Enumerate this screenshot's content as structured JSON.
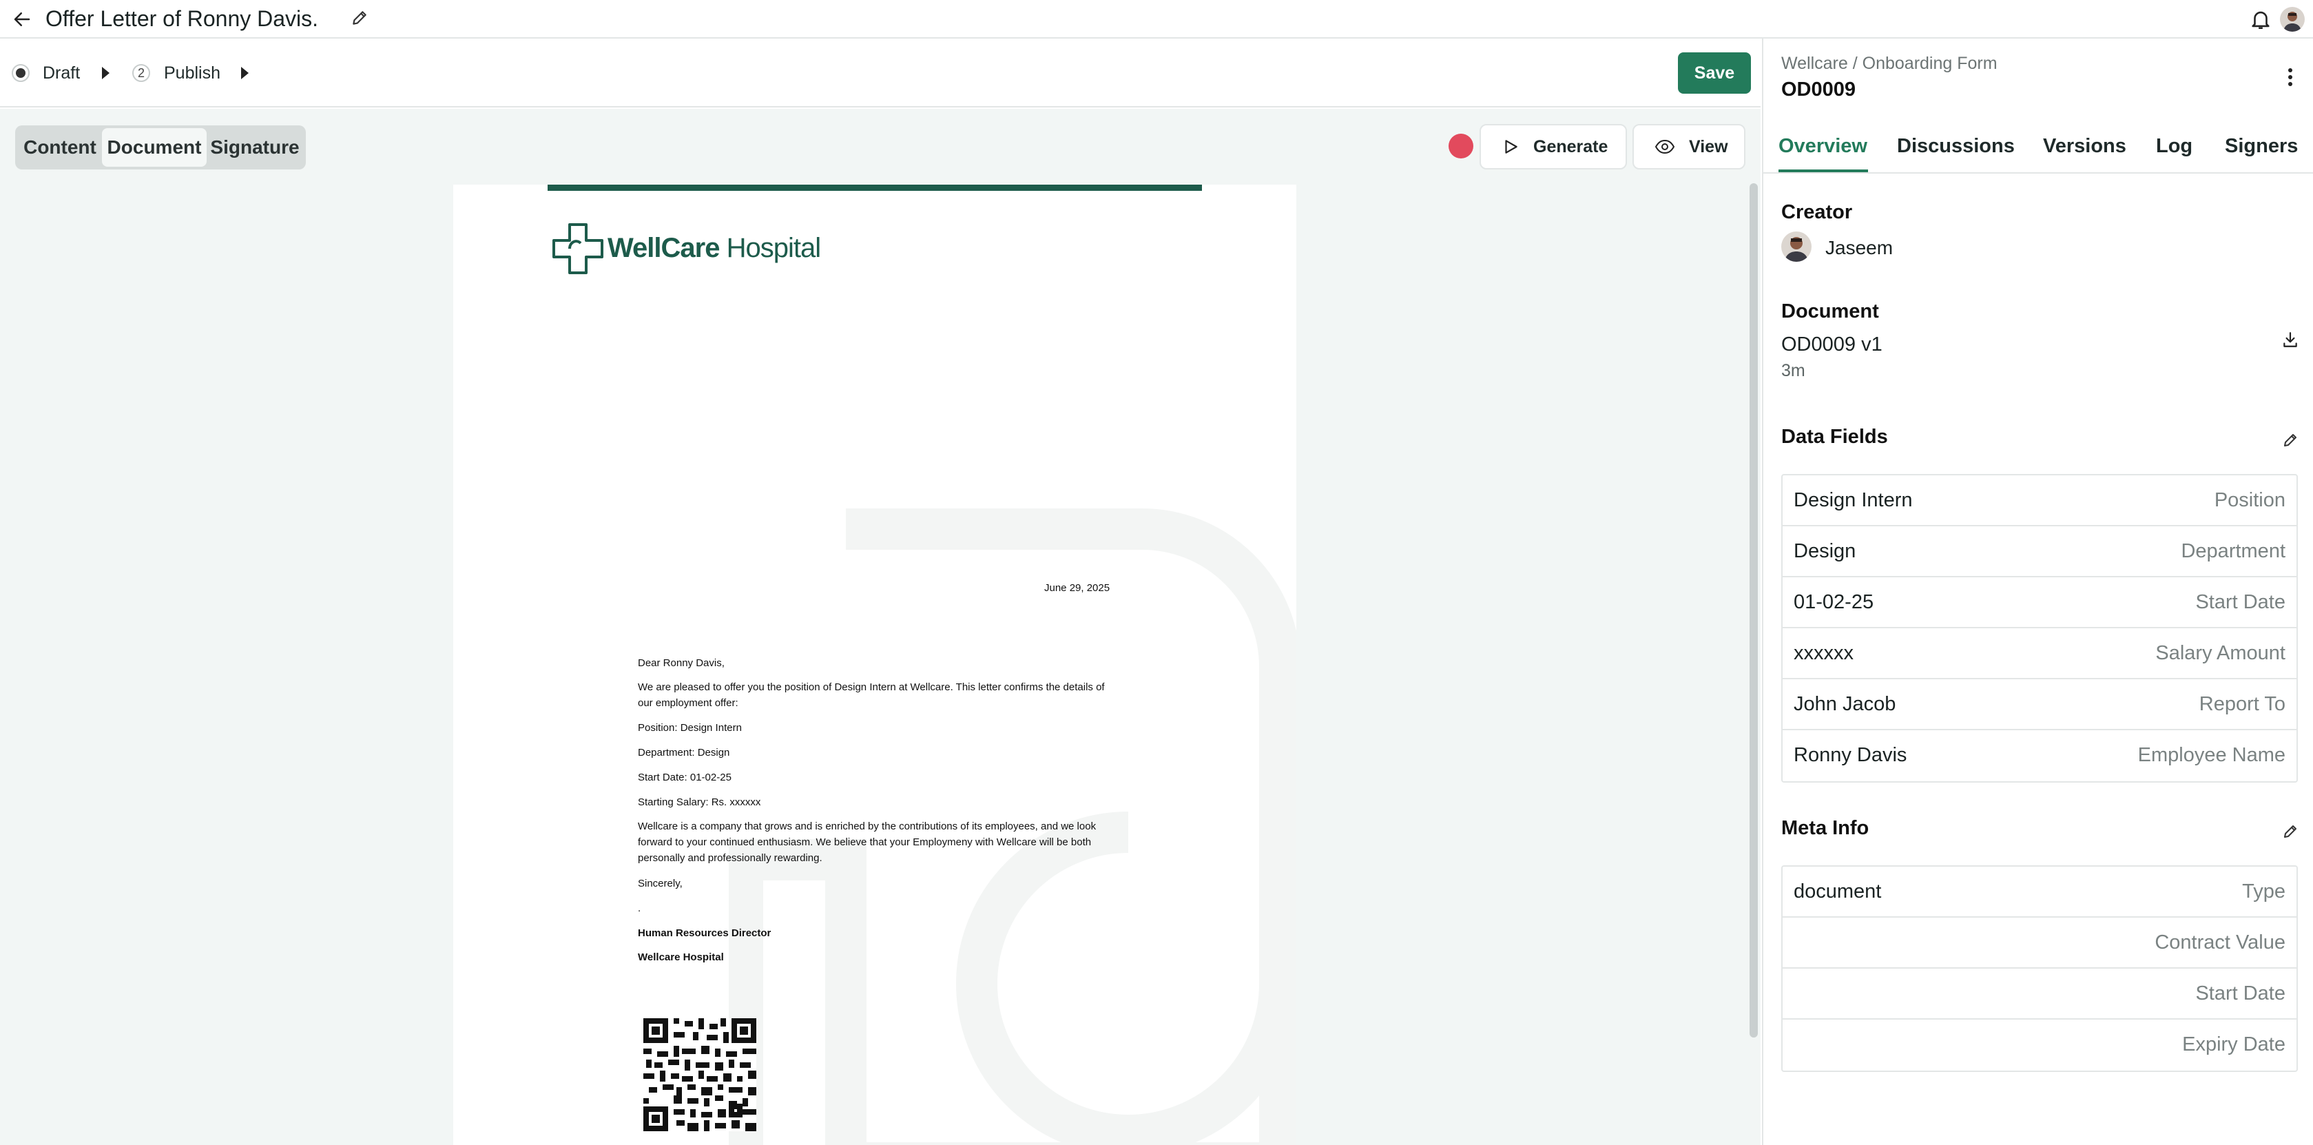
{
  "header": {
    "title": "Offer Letter of Ronny Davis."
  },
  "workflow": {
    "steps": [
      {
        "label": "Draft",
        "number": ""
      },
      {
        "label": "Publish",
        "number": "2"
      }
    ],
    "save_label": "Save"
  },
  "canvas": {
    "view_tabs": [
      "Content",
      "Document",
      "Signature"
    ],
    "active_view_tab": "Document",
    "generate_label": "Generate",
    "view_label": "View",
    "record_color": "#e24a5d"
  },
  "letter": {
    "logo_bold": "WellCare",
    "logo_light": " Hospital",
    "date": "June 29, 2025",
    "greeting": "Dear Ronny Davis,",
    "intro": "We are pleased to offer you the position of Design Intern at Wellcare.  This letter confirms the details of our employment offer:",
    "position": "Position: Design Intern",
    "department": "Department: Design",
    "start_date": "Start Date: 01-02-25",
    "salary": "Starting Salary: Rs. xxxxxx",
    "body": "Wellcare is a company that grows and is enriched by the contributions of its employees, and we look forward to your continued enthusiasm.  We believe that your Employmeny with Wellcare will be both personally and professionally rewarding.",
    "closing": "Sincerely,",
    "signature_mark": ".",
    "signer_title": "Human Resources Director",
    "signer_org": "Wellcare Hospital"
  },
  "panel": {
    "breadcrumb": "Wellcare / Onboarding Form",
    "code": "OD0009",
    "tabs": [
      "Overview",
      "Discussions",
      "Versions",
      "Log",
      "Signers"
    ],
    "active_tab": "Overview",
    "creator": {
      "title": "Creator",
      "name": "Jaseem"
    },
    "document": {
      "title": "Document",
      "version": "OD0009 v1",
      "age": "3m"
    },
    "data_fields": {
      "title": "Data Fields",
      "rows": [
        {
          "value": "Design Intern",
          "label": "Position"
        },
        {
          "value": "Design",
          "label": "Department"
        },
        {
          "value": "01-02-25",
          "label": "Start Date"
        },
        {
          "value": "xxxxxx",
          "label": "Salary Amount"
        },
        {
          "value": "John Jacob",
          "label": "Report To"
        },
        {
          "value": "Ronny Davis",
          "label": "Employee Name"
        }
      ]
    },
    "meta_info": {
      "title": "Meta Info",
      "rows": [
        {
          "value": "document",
          "label": "Type"
        },
        {
          "value": "",
          "label": "Contract Value"
        },
        {
          "value": "",
          "label": "Start Date"
        },
        {
          "value": "",
          "label": "Expiry Date"
        }
      ]
    }
  },
  "colors": {
    "accent": "#237b5b",
    "brand": "#1d5b4b",
    "record": "#e24a5d"
  },
  "icons": [
    "back-arrow-icon",
    "pencil-icon",
    "bell-icon",
    "play-icon",
    "eye-icon",
    "kebab-icon",
    "download-icon",
    "qr-code-icon"
  ]
}
